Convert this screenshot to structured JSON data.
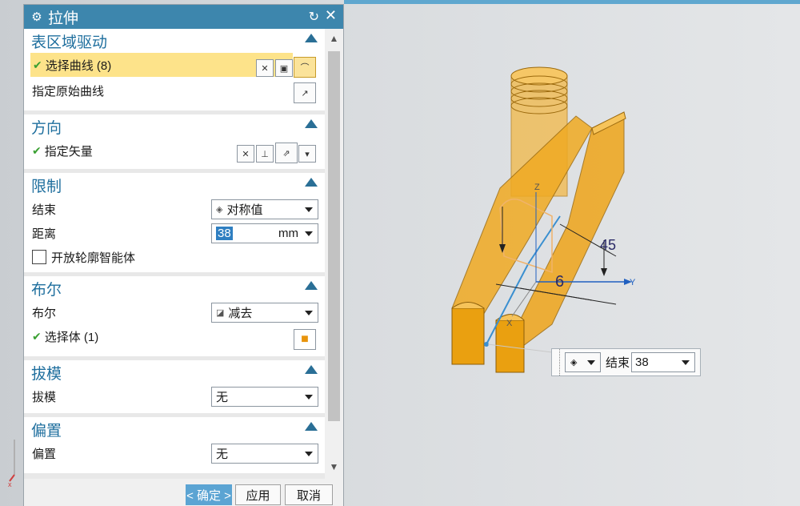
{
  "dialog": {
    "title": "拉伸",
    "sections": {
      "region": {
        "title": "表区域驱动",
        "select_curve": "选择曲线 (8)",
        "origin_curve": "指定原始曲线"
      },
      "direction": {
        "title": "方向",
        "vector": "指定矢量"
      },
      "limits": {
        "title": "限制",
        "end_label": "结束",
        "end_value": "对称值",
        "distance_label": "距离",
        "distance_value": "38",
        "distance_unit": "mm",
        "open_profile": "开放轮廓智能体"
      },
      "boolean": {
        "title": "布尔",
        "label": "布尔",
        "value": "减去",
        "select_body": "选择体 (1)"
      },
      "draft": {
        "title": "拔模",
        "label": "拔模",
        "value": "无"
      },
      "offset": {
        "title": "偏置",
        "label": "偏置",
        "value": "无"
      }
    },
    "footer": {
      "ok": "< 确定 >",
      "apply": "应用",
      "cancel": "取消"
    }
  },
  "viewport": {
    "float_label": "结束",
    "float_value": "38",
    "dim_value_1": "6",
    "dim_value_2": "45",
    "axis_x": "X",
    "axis_y": "Y",
    "axis_z": "Z"
  },
  "colors": {
    "header": "#3d86ad",
    "accent": "#1f6f9e",
    "highlight": "#fde38a",
    "model": "#f2a91e"
  }
}
